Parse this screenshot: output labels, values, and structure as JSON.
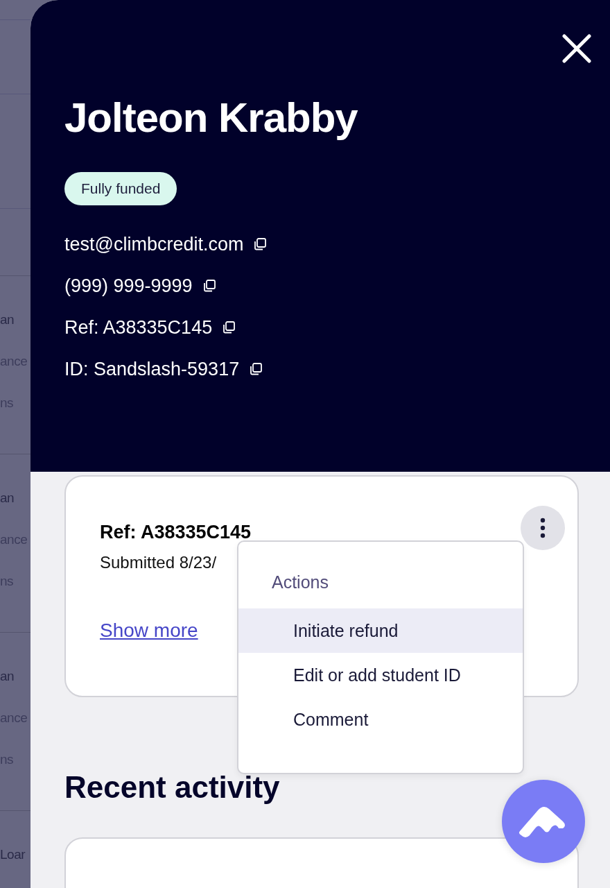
{
  "background": {
    "groups": [
      {
        "lines": [
          "an",
          "ance",
          "ns"
        ]
      },
      {
        "lines": [
          "an",
          "ance",
          "ns"
        ]
      },
      {
        "lines": [
          "an",
          "ance",
          "ns"
        ]
      },
      {
        "lines": [
          "Loar"
        ]
      }
    ]
  },
  "panel": {
    "title": "Jolteon Krabby",
    "status_badge": "Fully funded",
    "contacts": [
      {
        "text": "test@climbcredit.com"
      },
      {
        "text": "(999) 999-9999"
      },
      {
        "text": "Ref: A38335C145"
      },
      {
        "text": "ID: Sandslash-59317"
      }
    ],
    "loan_card": {
      "title": "Ref: A38335C145",
      "submitted": "Submitted 8/23/",
      "link": "Show more"
    },
    "menu": {
      "heading": "Actions",
      "items": [
        {
          "label": "Initiate refund",
          "selected": true
        },
        {
          "label": "Edit or add student ID",
          "selected": false
        },
        {
          "label": "Comment",
          "selected": false
        }
      ]
    },
    "section_title": "Recent activity"
  }
}
